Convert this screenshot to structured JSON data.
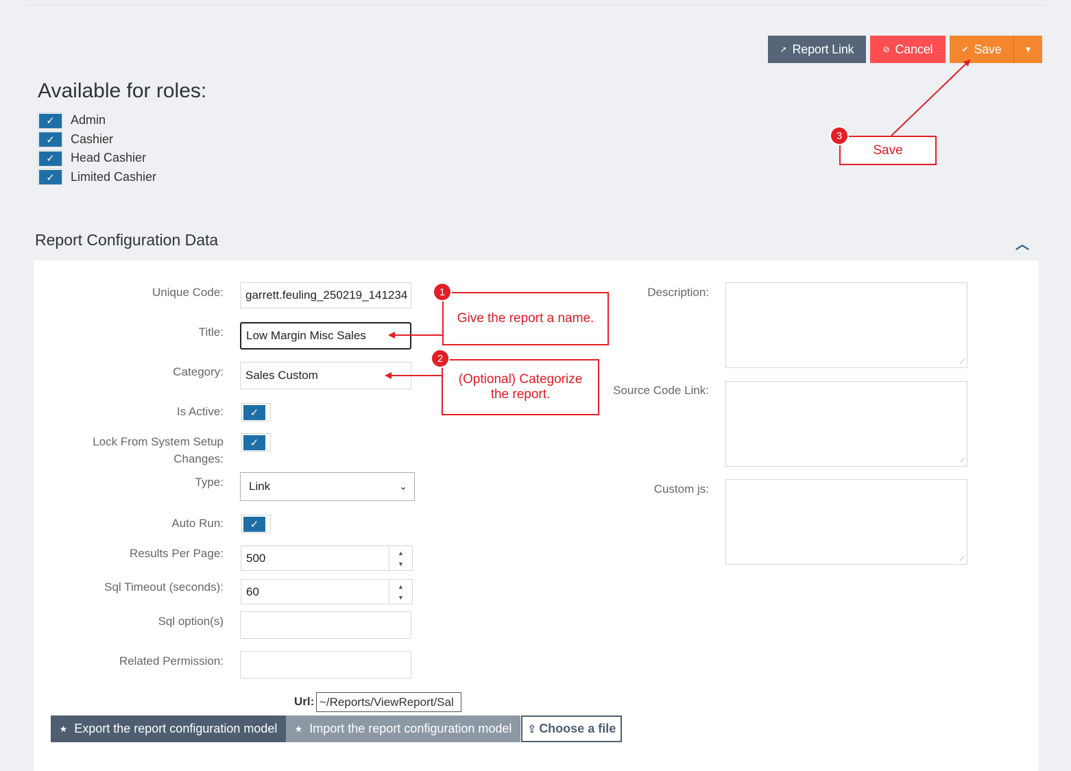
{
  "toolbar": {
    "report_link_label": "Report Link",
    "cancel_label": "Cancel",
    "save_label": "Save"
  },
  "roles": {
    "title": "Available for roles:",
    "items": [
      {
        "label": "Admin",
        "checked": true
      },
      {
        "label": "Cashier",
        "checked": true
      },
      {
        "label": "Head Cashier",
        "checked": true
      },
      {
        "label": "Limited Cashier",
        "checked": true
      }
    ]
  },
  "section": {
    "title": "Report Configuration Data"
  },
  "form": {
    "unique_code": {
      "label": "Unique Code:",
      "value": "garrett.feuling_250219_141234"
    },
    "title": {
      "label": "Title:",
      "value": "Low Margin Misc Sales"
    },
    "category": {
      "label": "Category:",
      "value": "Sales Custom"
    },
    "is_active": {
      "label": "Is Active:",
      "checked": true
    },
    "lock_from_setup": {
      "label_line1": "Lock From System Setup",
      "label_line2": "Changes:",
      "checked": true
    },
    "type": {
      "label": "Type:",
      "value": "Link"
    },
    "auto_run": {
      "label": "Auto Run:",
      "checked": true
    },
    "results_per_page": {
      "label": "Results Per Page:",
      "value": "500"
    },
    "sql_timeout": {
      "label": "Sql Timeout (seconds):",
      "value": "60"
    },
    "sql_options": {
      "label": "Sql option(s)",
      "value": ""
    },
    "related_permission": {
      "label": "Related Permission:",
      "value": ""
    },
    "description": {
      "label": "Description:",
      "value": ""
    },
    "source_code_link": {
      "label": "Source Code Link:",
      "value": ""
    },
    "custom_js": {
      "label": "Custom js:",
      "value": ""
    },
    "url": {
      "label": "Url:",
      "value": "~/Reports/ViewReport/Sal"
    }
  },
  "bottom_buttons": {
    "export_label": "Export the report configuration model",
    "import_label": "Import the report configuration model",
    "choose_label": "Choose a file"
  },
  "annotations": {
    "step1": {
      "number": "1",
      "text": "Give the report a name."
    },
    "step2": {
      "number": "2",
      "text_line1": "(Optional) Categorize",
      "text_line2": "the report."
    },
    "step3": {
      "number": "3",
      "text": "Save"
    },
    "color": "#e41e26"
  },
  "colors": {
    "accent_blue": "#1f6fa7",
    "save_orange": "#f4872d",
    "cancel_red": "#fd4f52",
    "slate": "#566577"
  }
}
